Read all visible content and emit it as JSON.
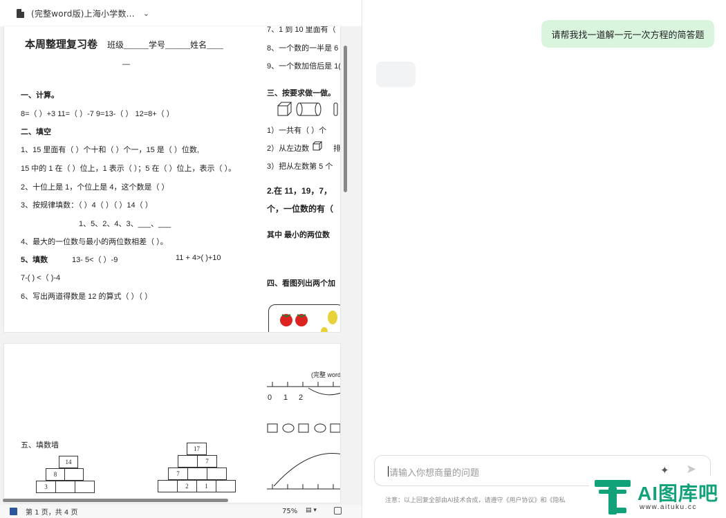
{
  "doc": {
    "file_title": "(完整word版)上海小学数...",
    "status_pages": "第 1 页，共 4 页",
    "zoom": "75%"
  },
  "page1": {
    "title": "本周整理复习卷",
    "title_fields": "班级______学号______姓名____",
    "title_dash": "—",
    "s1": "一、计算。",
    "s1_q": "8=（  ）+3      11=（  ）-7      9=13-（  ）      12=8+（  ）",
    "s2": "二、填空",
    "q1a": "1、15 里面有（      ）个十和（      ）个一，15 是（  ）位数,",
    "q1b": "15 中的 1 在（  ）位上，1 表示（  ）；5 在（  ）位上，表示（  ）。",
    "q2": "2、十位上是 1，个位上是 4，这个数是（  ）",
    "q3": "3、按规律填数：（  ）4（  ）（  ）14（  ）",
    "q3b": "1、5、2、4、3、___、___",
    "q4": "4、最大的一位数与最小的两位数相差（      ）。",
    "q5_label": "5、填数",
    "q5a": "13-  5<（  ）-9",
    "q5b": "11 + 4>(    )+10",
    "q5c": "7-(   ) <（  )-4",
    "q6": "6、写出两道得数是 12 的算式（              ）（              ）",
    "r7": "7、1 到 10 里面有（",
    "r8": "8、一个数的一半是 6",
    "r9": "9、一个数加倍后是 1(",
    "r_s3": "三、按要求做一做。",
    "r_a": "1）一共有（    ）个",
    "r_b": "2）从左边数",
    "r_b2": "排",
    "r_c": "3）把从左数第 5 个",
    "r_d": "2.在 11，19，7，",
    "r_e": "个，一位数的有（",
    "r_f": "其中  最小的两位数",
    "r_s4": "四、看图列出两个加"
  },
  "page2": {
    "header_right": "(完整 word",
    "numline": [
      "0",
      "1",
      "2"
    ],
    "s5": "五、填数墙",
    "pyr1": {
      "top": "14",
      "mid": "8",
      "bottom_left": "3"
    },
    "pyr2": {
      "top": "17",
      "row2_right": "7",
      "row3_left": "7",
      "row4_mid1": "2",
      "row4_mid2": "1"
    }
  },
  "chat": {
    "user_message": "请帮我找一道解一元一次方程的简答题",
    "input_placeholder": "请输入你想商量的问题",
    "notice": "注意：以上回复全部由AI技术合成，请遵守《用户协议》和《隐私"
  },
  "watermark": {
    "text": "AI图库吧",
    "url": "www.aituku.cc",
    "color": "#11a27a"
  }
}
